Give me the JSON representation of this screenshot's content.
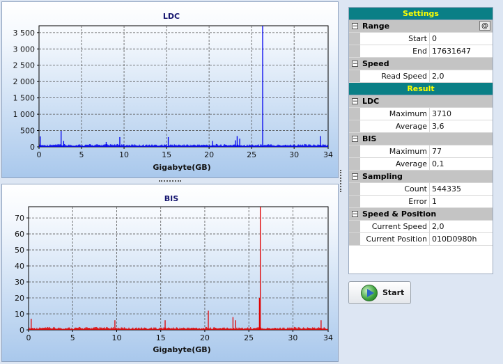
{
  "charts": {
    "ldc": {
      "title": "LDC",
      "xlabel": "Gigabyte(GB)"
    },
    "bis": {
      "title": "BIS",
      "xlabel": "Gigabyte(GB)"
    }
  },
  "chart_data": [
    {
      "type": "bar",
      "title": "LDC",
      "xlabel": "Gigabyte(GB)",
      "ylabel": "",
      "xlim": [
        0,
        34
      ],
      "ylim": [
        0,
        3710
      ],
      "xticks": [
        0,
        5,
        10,
        15,
        20,
        25,
        30,
        34
      ],
      "yticks": [
        0,
        500,
        1000,
        1500,
        2000,
        2500,
        3000,
        3500
      ],
      "ytick_labels": [
        "0",
        "500",
        "1 000",
        "1 500",
        "2 000",
        "2 500",
        "3 000",
        "3 500"
      ],
      "grid": true,
      "color": "#0000ee",
      "baseline_approx": 3.6,
      "x": [
        0.15,
        2.6,
        2.9,
        7.9,
        9.5,
        15.2,
        20.4,
        23.1,
        23.3,
        23.6,
        26.3,
        33.1
      ],
      "values": [
        320,
        490,
        180,
        150,
        300,
        300,
        180,
        200,
        330,
        250,
        3710,
        330
      ]
    },
    {
      "type": "bar",
      "title": "BIS",
      "xlabel": "Gigabyte(GB)",
      "ylabel": "",
      "xlim": [
        0,
        34
      ],
      "ylim": [
        0,
        77
      ],
      "xticks": [
        0,
        5,
        10,
        15,
        20,
        25,
        30,
        34
      ],
      "yticks": [
        0,
        10,
        20,
        30,
        40,
        50,
        60,
        70
      ],
      "ytick_labels": [
        "0",
        "10",
        "20",
        "30",
        "40",
        "50",
        "60",
        "70"
      ],
      "grid": true,
      "color": "#e00000",
      "baseline_approx": 0.1,
      "x": [
        0.3,
        9.8,
        15.5,
        20.4,
        23.2,
        23.5,
        26.2,
        26.3,
        33.2
      ],
      "values": [
        7,
        6,
        6,
        12,
        8,
        6,
        20,
        77,
        6
      ]
    }
  ],
  "settings": {
    "header": "Settings",
    "range": {
      "label": "Range",
      "button": "@",
      "start_label": "Start",
      "start": "0",
      "end_label": "End",
      "end": "17631647"
    },
    "speed": {
      "label": "Speed",
      "read_label": "Read Speed",
      "read": "2,0"
    }
  },
  "result": {
    "header": "Result",
    "ldc": {
      "label": "LDC",
      "max_label": "Maximum",
      "max": "3710",
      "avg_label": "Average",
      "avg": "3,6"
    },
    "bis": {
      "label": "BIS",
      "max_label": "Maximum",
      "max": "77",
      "avg_label": "Average",
      "avg": "0,1"
    },
    "sampling": {
      "label": "Sampling",
      "count_label": "Count",
      "count": "544335",
      "error_label": "Error",
      "error": "1"
    },
    "speedpos": {
      "label": "Speed & Position",
      "speed_label": "Current Speed",
      "speed": "2,0",
      "pos_label": "Current Position",
      "pos": "010D0980h"
    }
  },
  "start_button": {
    "label": "Start"
  },
  "colors": {
    "section_header_bg": "#0a7f86",
    "section_header_text": "#ffff00",
    "category_bg": "#c4c4c4"
  }
}
